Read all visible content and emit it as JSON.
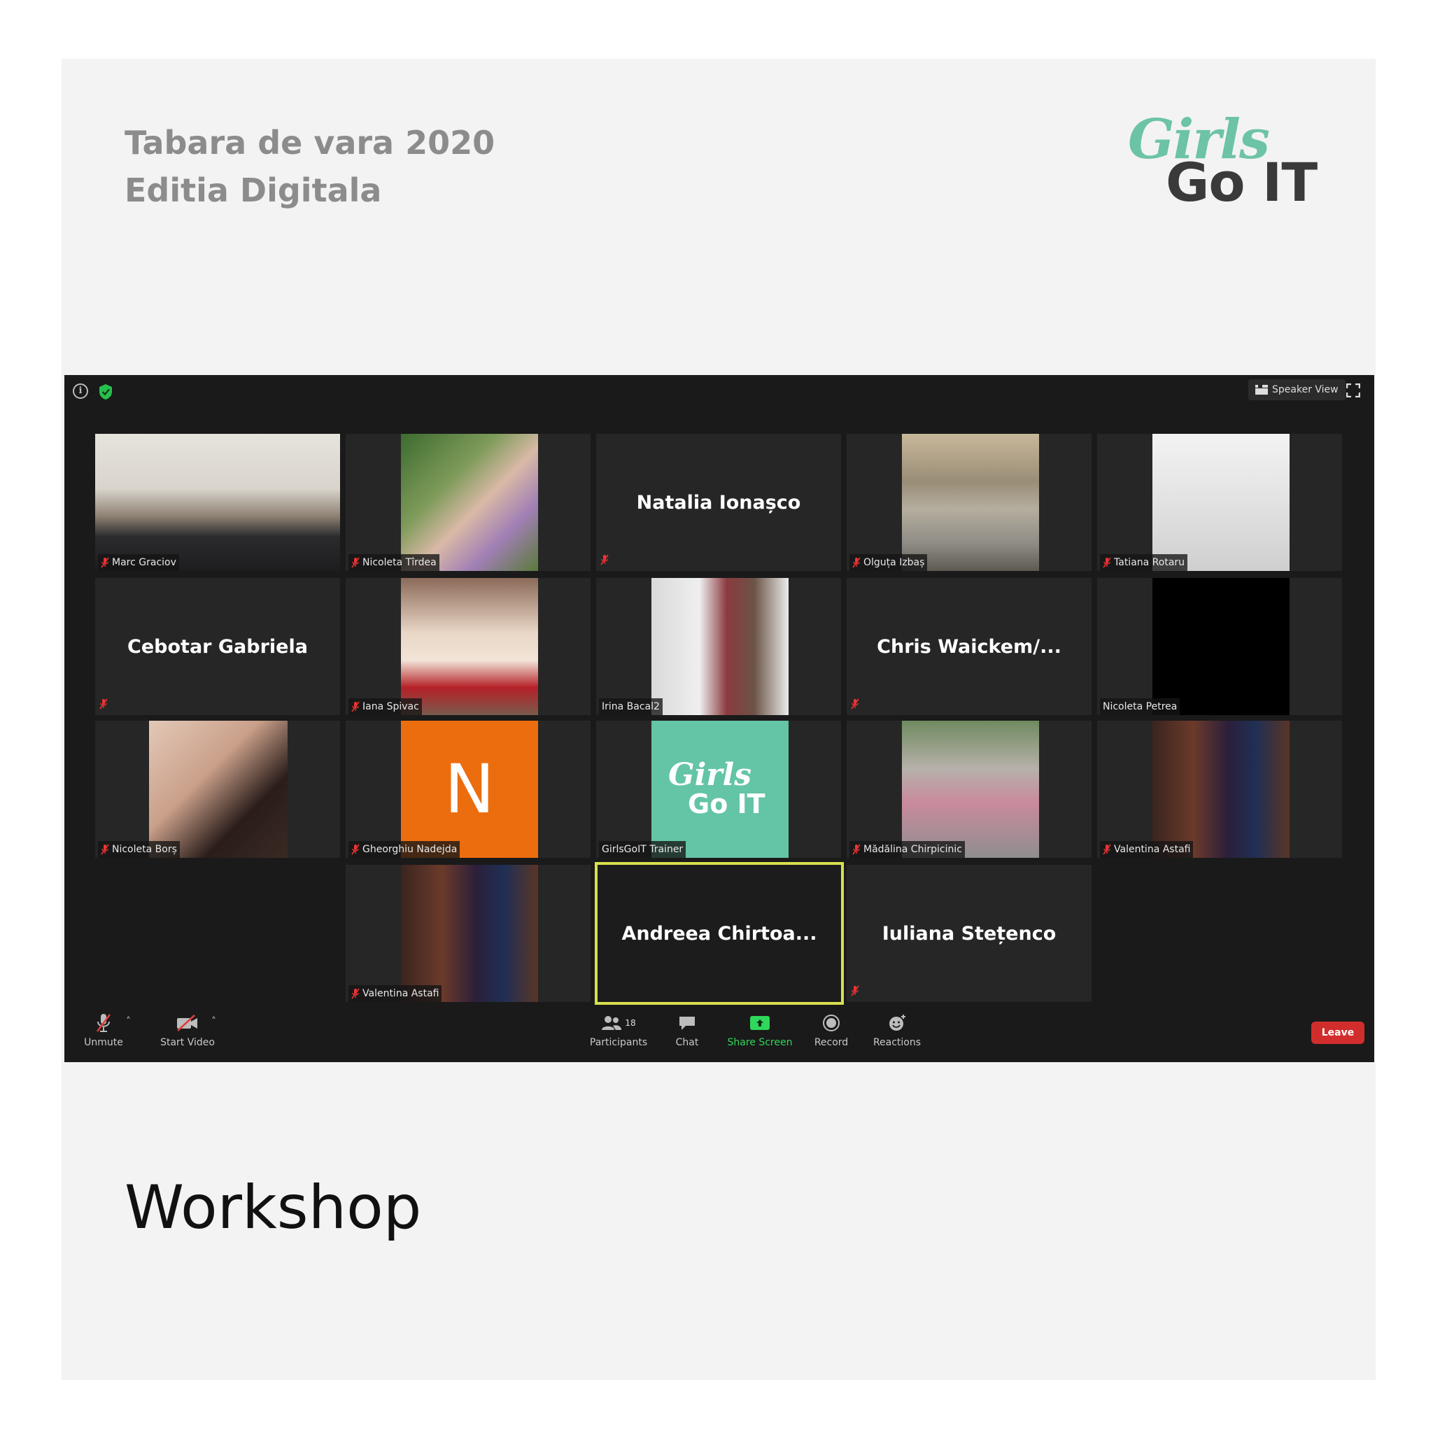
{
  "header": {
    "line1": "Tabara de vara 2020",
    "line2": "Editia Digitala"
  },
  "logo": {
    "girls": "Girls",
    "goit": "Go IT"
  },
  "footer": {
    "caption": "Workshop"
  },
  "zoom": {
    "speaker_view_label": "Speaker View",
    "tiles": [
      {
        "name": "Marc Graciov",
        "kind": "video",
        "muted": true
      },
      {
        "name": "Nicoleta Tîrdea",
        "kind": "video",
        "muted": true
      },
      {
        "name": "Natalia Ionașco",
        "kind": "name",
        "muted": true
      },
      {
        "name": "Olguța Izbaș",
        "kind": "video",
        "muted": true
      },
      {
        "name": "Tatiana Rotaru",
        "kind": "video",
        "muted": true
      },
      {
        "name": "Cebotar Gabriela",
        "kind": "name",
        "muted": true
      },
      {
        "name": "Iana Spivac",
        "kind": "video",
        "muted": true
      },
      {
        "name": "Irina Bacal2",
        "kind": "video",
        "muted": false
      },
      {
        "name": "Chris  Waickem/...",
        "kind": "name",
        "muted": true
      },
      {
        "name": "Nicoleta Petrea",
        "kind": "video",
        "muted": false
      },
      {
        "name": "Nicoleta Borș",
        "kind": "video",
        "muted": true
      },
      {
        "name": "Gheorghiu Nadejda",
        "kind": "avatar",
        "muted": true,
        "avatar_letter": "N"
      },
      {
        "name": "GirlsGoIT Trainer",
        "kind": "logo",
        "muted": false
      },
      {
        "name": "Mădălina Chirpicinic",
        "kind": "video",
        "muted": true
      },
      {
        "name": "Valentina Astafi",
        "kind": "video",
        "muted": true
      },
      {
        "name": "Valentina Astafi",
        "kind": "video",
        "muted": true
      },
      {
        "name": "Andreea  Chirtoa...",
        "kind": "name",
        "muted": false,
        "active_speaker": true
      },
      {
        "name": "Iuliana Stețenco",
        "kind": "name",
        "muted": true
      }
    ],
    "toolbar": {
      "unmute": "Unmute",
      "start_video": "Start Video",
      "participants": "Participants",
      "participants_count": "18",
      "chat": "Chat",
      "share_screen": "Share Screen",
      "record": "Record",
      "reactions": "Reactions",
      "leave": "Leave"
    },
    "colors": {
      "share_screen": "#2fd75a",
      "leave": "#d22d2d",
      "active_speaker_border": "#d9e04e",
      "logo_green": "#6cc3a6"
    }
  }
}
